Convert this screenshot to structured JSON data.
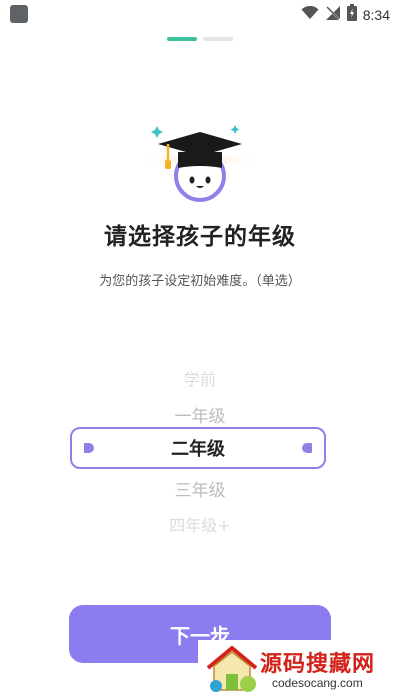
{
  "status_bar": {
    "time": "8:34"
  },
  "pager": {
    "steps": 2,
    "active": 0
  },
  "onboarding": {
    "title": "请选择孩子的年级",
    "subtitle": "为您的孩子设定初始难度。（单选）"
  },
  "picker": {
    "options": [
      "学前",
      "一年级",
      "二年级",
      "三年级",
      "四年级+"
    ],
    "selected_index": 2
  },
  "actions": {
    "next_label": "下一步"
  },
  "watermark": {
    "title": "源码搜藏网",
    "url": "codesocang.com"
  },
  "colors": {
    "accent": "#8b7cf0",
    "pager_active": "#3cc29c",
    "watermark_red": "#d3221a"
  }
}
